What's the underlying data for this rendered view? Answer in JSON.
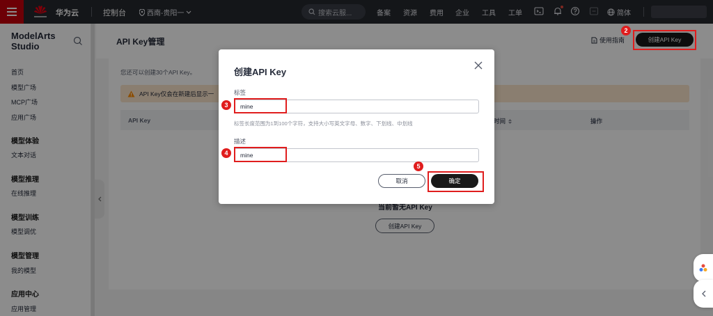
{
  "topbar": {
    "brand": "华为云",
    "console": "控制台",
    "region": "西南-贵阳一",
    "search_placeholder": "搜索云服...",
    "nav": [
      "备案",
      "资源",
      "费用",
      "企业",
      "工具",
      "工单"
    ],
    "language": "简体"
  },
  "sidebar": {
    "title": "ModelArts Studio",
    "top_items": [
      "首页",
      "模型广场",
      "MCP广场",
      "应用广场"
    ],
    "groups": [
      {
        "title": "模型体验",
        "items": [
          "文本对话"
        ]
      },
      {
        "title": "模型推理",
        "items": [
          "在线推理"
        ]
      },
      {
        "title": "模型训练",
        "items": [
          "模型调优"
        ]
      },
      {
        "title": "模型管理",
        "items": [
          "我的模型"
        ]
      },
      {
        "title": "应用中心",
        "items": [
          "应用管理"
        ]
      }
    ]
  },
  "header": {
    "title": "API Key管理",
    "guide_label": "使用指南",
    "create_label": "创建API Key"
  },
  "content": {
    "quota_text": "您还可以创建30个API Key。",
    "warning_text": "API Key仅会在新建后显示一",
    "table_headers": {
      "api_key": "API Key",
      "created": "时间",
      "actions": "操作"
    },
    "empty_text": "当前暂无API Key",
    "empty_button": "创建API Key"
  },
  "dialog": {
    "title": "创建API Key",
    "tag_label": "标签",
    "tag_value": "mine",
    "tag_hint": "标签长度范围为1到100个字符，支持大小写英文字母、数字、下划线、中划线",
    "desc_label": "描述",
    "desc_value": "mine",
    "cancel_label": "取消",
    "ok_label": "确定"
  },
  "annotations": {
    "step2": "2",
    "step3": "3",
    "step4": "4",
    "step5": "5"
  },
  "colors": {
    "topbar": "#26282e",
    "brand_red": "#c7000b",
    "primary_button": "#191919",
    "warning_bg": "#fbe6cc",
    "highlight": "#e01d1d"
  }
}
